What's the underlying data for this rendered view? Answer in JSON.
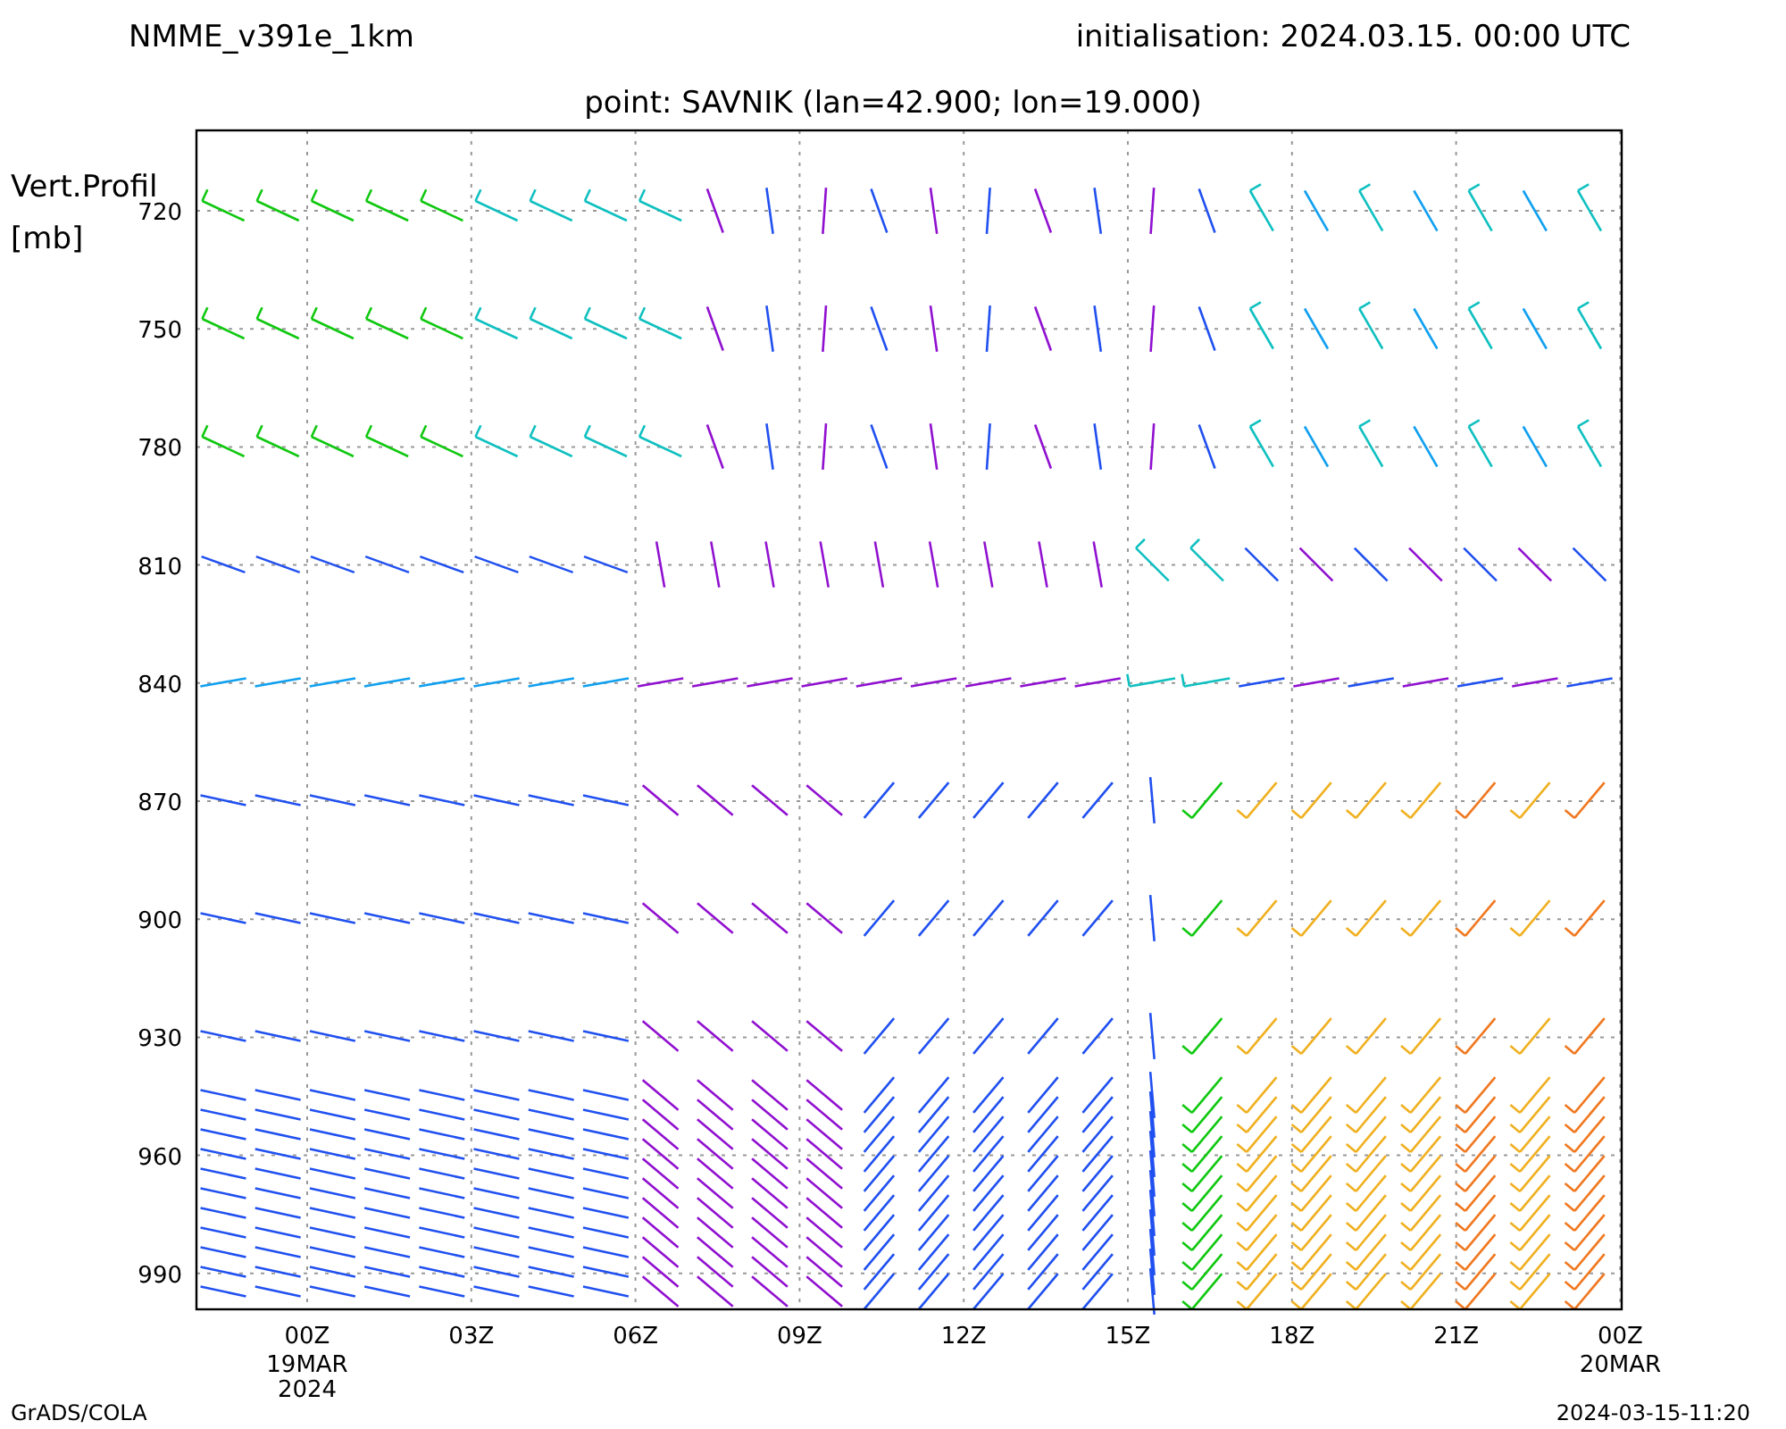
{
  "header": {
    "model": "NMME_v391e_1km",
    "initialisation": "initialisation: 2024.03.15. 00:00 UTC",
    "point": "point: SAVNIK (lan=42.900; lon=19.000)"
  },
  "y_axis": {
    "label": "Vert.Profil",
    "unit": "[mb]",
    "ticks": [
      "720",
      "750",
      "780",
      "810",
      "840",
      "870",
      "900",
      "930",
      "960",
      "990"
    ]
  },
  "x_axis": {
    "ticks": [
      {
        "label": "00Z",
        "sub": [
          "19MAR",
          "2024"
        ]
      },
      {
        "label": "03Z"
      },
      {
        "label": "06Z"
      },
      {
        "label": "09Z"
      },
      {
        "label": "12Z"
      },
      {
        "label": "15Z"
      },
      {
        "label": "18Z"
      },
      {
        "label": "21Z"
      },
      {
        "label": "00Z",
        "sub": [
          "20MAR"
        ]
      }
    ]
  },
  "footer": {
    "left": "GrADS/COLA",
    "right": "2024-03-15-11:20"
  }
}
